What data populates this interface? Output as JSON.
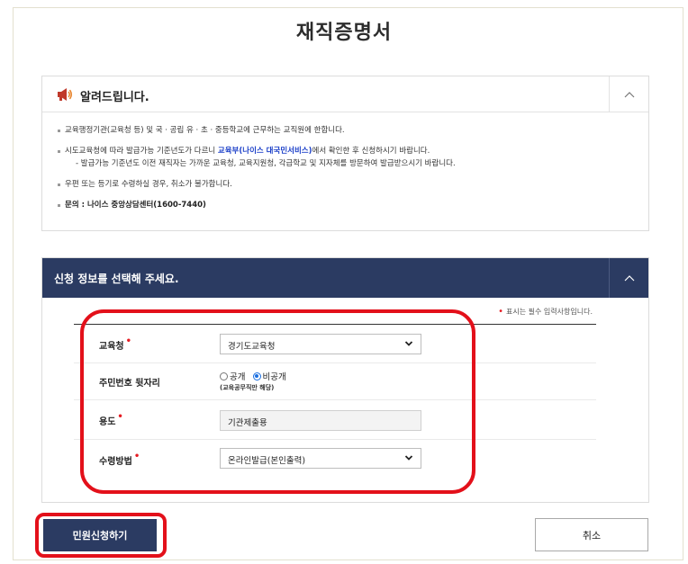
{
  "page": {
    "title": "재직증명서"
  },
  "notice": {
    "title": "알려드립니다.",
    "icon": "megaphone-icon",
    "items": {
      "l1": "교육행정기관(교육청 등) 및 국 · 공립 유 · 초 · 중등학교에 근무하는 교직원에 한합니다.",
      "l2_pre": "시도교육청에 따라 발급가능 기준년도가 다르니 ",
      "l2_link": "교육부(나이스 대국민서비스)",
      "l2_post": "에서 확인한 후 신청하시기 바랍니다.",
      "l2_sub": "- 발급가능 기준년도 이전 재직자는 가까운 교육청, 교육지원청, 각급학교 및 지자체를 방문하여 발급받으시기 바랍니다.",
      "l3": "우편 또는 등기로 수령하실 경우, 취소가 불가합니다.",
      "l4": "문의 : 나이스 중앙상담센터(1600-7440)"
    }
  },
  "apply": {
    "title": "신청 정보를 선택해 주세요.",
    "required_note": "표시는 필수 입력사항입니다.",
    "required_mark": "•",
    "fields": {
      "office": {
        "label": "교육청",
        "value": "경기도교육청"
      },
      "resident": {
        "label": "주민번호 뒷자리",
        "opt_public": "공개",
        "opt_private": "비공개",
        "selected": "비공개",
        "hint": "(교육공무직만 해당)"
      },
      "purpose": {
        "label": "용도",
        "value": "기관제출용"
      },
      "receive": {
        "label": "수령방법",
        "value": "온라인발급(본인출력)"
      }
    }
  },
  "buttons": {
    "submit": "민원신청하기",
    "cancel": "취소"
  },
  "colors": {
    "navy": "#2b3b62",
    "required": "#e51c23",
    "link": "#1b3fc8",
    "annotation": "#e3101a"
  }
}
